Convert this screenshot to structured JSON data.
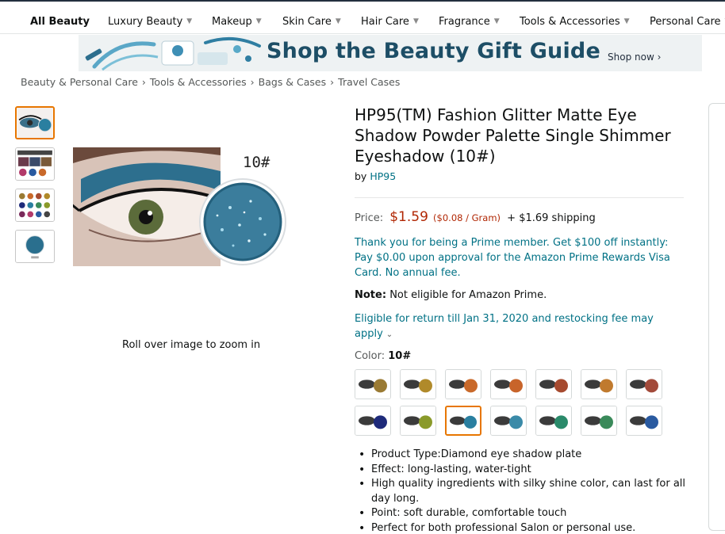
{
  "topnav": {
    "items": [
      {
        "label": "All Beauty",
        "bold": true,
        "caret": false
      },
      {
        "label": "Luxury Beauty",
        "bold": false,
        "caret": true
      },
      {
        "label": "Makeup",
        "bold": false,
        "caret": true
      },
      {
        "label": "Skin Care",
        "bold": false,
        "caret": true
      },
      {
        "label": "Hair Care",
        "bold": false,
        "caret": true
      },
      {
        "label": "Fragrance",
        "bold": false,
        "caret": true
      },
      {
        "label": "Tools & Accessories",
        "bold": false,
        "caret": true
      },
      {
        "label": "Personal Care",
        "bold": false,
        "caret": true
      }
    ]
  },
  "banner": {
    "headline": "Shop the Beauty Gift Guide",
    "cta": "Shop now ›"
  },
  "breadcrumb": [
    "Beauty & Personal Care",
    "Tools & Accessories",
    "Bags & Cases",
    "Travel Cases"
  ],
  "breadcrumb_sep": "›",
  "gallery": {
    "image_label": "10#",
    "zoom_hint": "Roll over image to zoom in"
  },
  "product": {
    "title": "HP95(TM) Fashion Glitter Matte Eye Shadow Powder Palette Single Shimmer Eyeshadow (10#)",
    "by_prefix": "by",
    "brand": "HP95",
    "price_label": "Price:",
    "price": "$1.59",
    "unit_price": "($0.08 / Gram)",
    "shipping": "+ $1.69 shipping",
    "prime_message": "Thank you for being a Prime member. Get $100 off instantly: Pay $0.00 upon approval for the Amazon Prime Rewards Visa Card. No annual fee.",
    "note_label": "Note:",
    "note_text": "Not eligible for Amazon Prime.",
    "returns_text": "Eligible for return till Jan 31, 2020 and restocking fee may apply",
    "returns_chevron": "⌄",
    "color_label": "Color:",
    "color_value": "10#"
  },
  "swatches": {
    "row1": [
      "#9a7a33",
      "#b08a2a",
      "#c9692a",
      "#c8642a",
      "#a64a2f",
      "#c07a2e",
      "#a24a3a"
    ],
    "row2": [
      "#1e2a7a",
      "#8a9a2a",
      "#2a7fa0",
      "#3a8aa8",
      "#2a8a6a",
      "#3a8a5a",
      "#2a5aa0"
    ],
    "selected": "row2-2"
  },
  "bullets": [
    "Product Type:Diamond eye shadow plate",
    "Effect: long-lasting, water-tight",
    "High quality ingredients with silky shine color, can last for all day long.",
    "Point: soft durable, comfortable touch",
    "Perfect for both professional Salon or personal use."
  ],
  "colors": {
    "link": "#007185",
    "price": "#b12704",
    "selected_border": "#e77600",
    "banner_text": "#1d4e66"
  }
}
